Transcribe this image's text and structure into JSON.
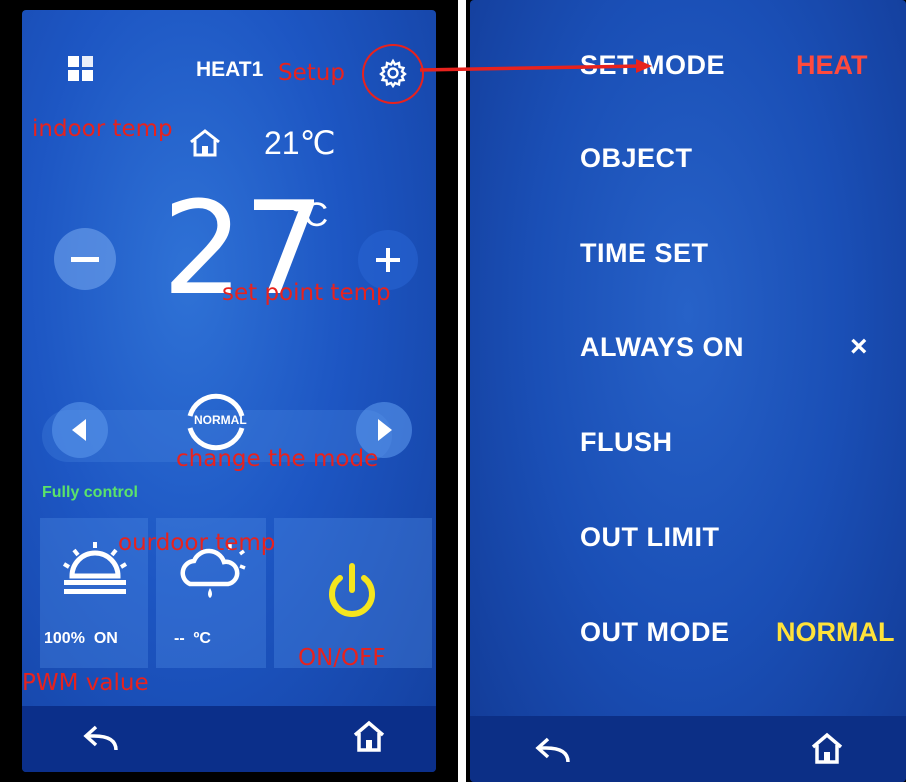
{
  "left_screen": {
    "header_title": "HEAT1",
    "indoor_temp": "21℃",
    "set_point_value": "27",
    "set_point_unit": "°C",
    "minus_label": "−",
    "plus_label": "+",
    "mode_label": "NORMAL",
    "fully_control": "Fully control",
    "pwm_readout": "100%  ON",
    "outdoor_readout": "--  ºC",
    "nav": {
      "back_icon": "back-arrow-icon",
      "home_icon": "home-icon"
    }
  },
  "right_screen": {
    "items": [
      {
        "label": "SET MODE",
        "value": "HEAT",
        "value_color": "#ff4a3d"
      },
      {
        "label": "OBJECT",
        "value": ""
      },
      {
        "label": "TIME SET",
        "value": ""
      },
      {
        "label": "ALWAYS ON",
        "value": "×",
        "value_color": "#ffffff"
      },
      {
        "label": "FLUSH",
        "value": ""
      },
      {
        "label": "OUT LIMIT",
        "value": ""
      },
      {
        "label": "OUT MODE",
        "value": "NORMAL",
        "value_color": "#ffe23a"
      }
    ]
  },
  "annotations": {
    "setup": "Setup",
    "indoor_temp": "indoor temp",
    "set_point_temp": "set point temp",
    "change_mode": "change the mode",
    "outdoor_temp": "ourdoor temp",
    "on_off": "ON/OFF",
    "pwm_value": "PWM value"
  },
  "colors": {
    "accent_red": "#e8221d",
    "power_yellow": "#f5e51e",
    "fully_control_green": "#5be36a"
  }
}
